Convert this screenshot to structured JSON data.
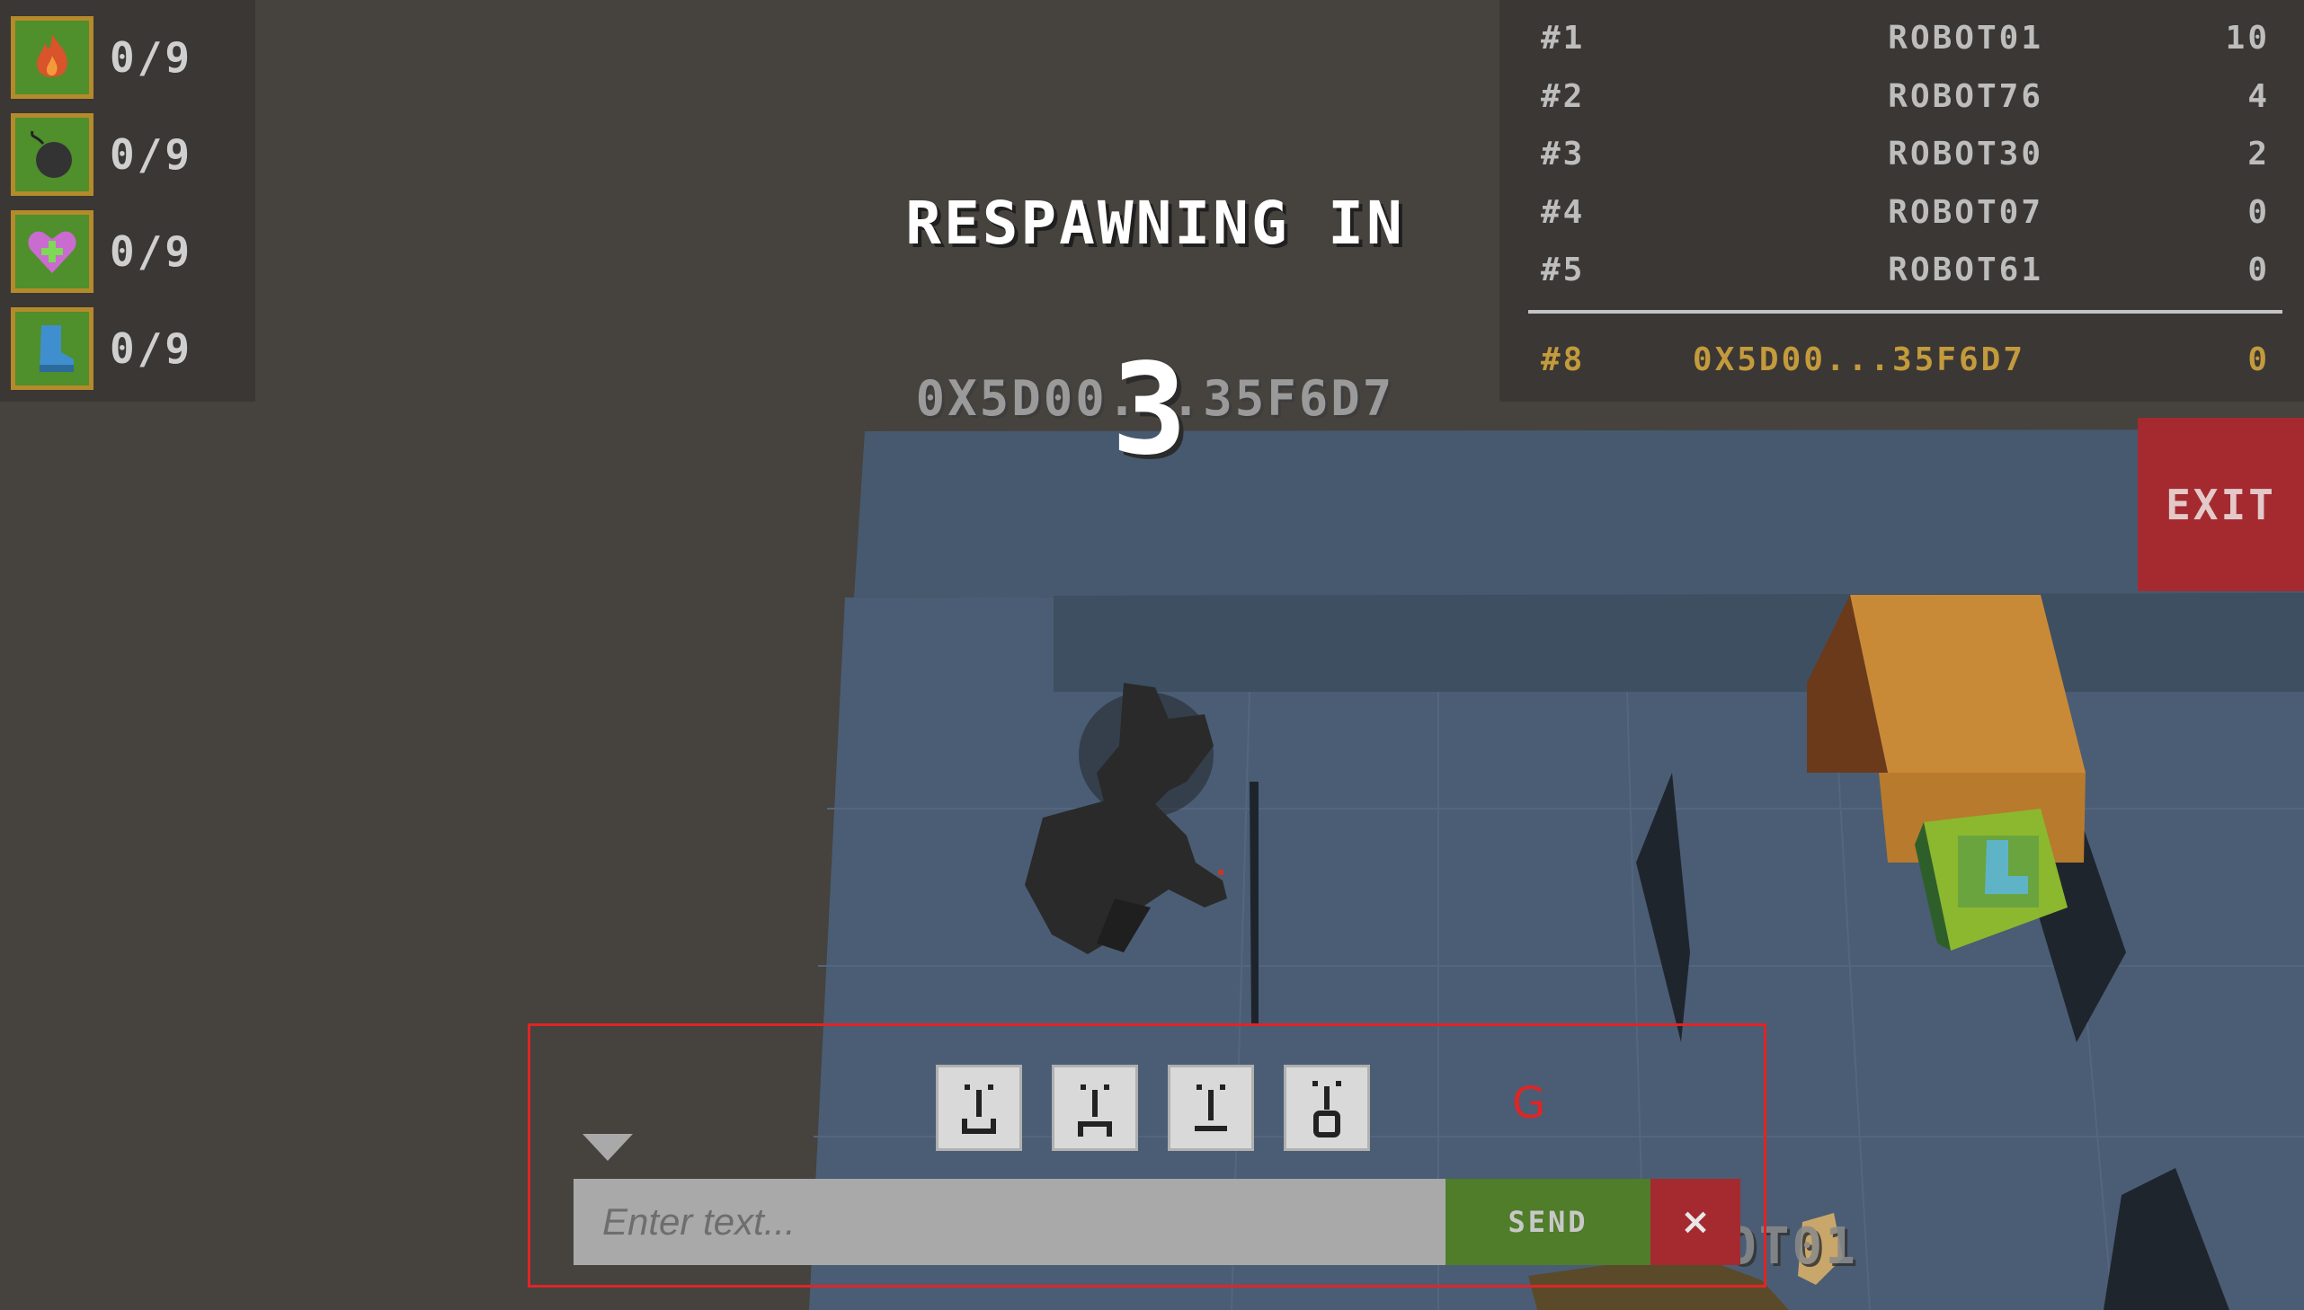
{
  "inventory": {
    "items": [
      {
        "icon": "fire-icon",
        "count": "0/9"
      },
      {
        "icon": "bomb-icon",
        "count": "0/9"
      },
      {
        "icon": "heart-icon",
        "count": "0/9"
      },
      {
        "icon": "boot-icon",
        "count": "0/9"
      }
    ]
  },
  "leaderboard": {
    "rows": [
      {
        "rank": "#1",
        "name": "ROBOT01",
        "score": "10"
      },
      {
        "rank": "#2",
        "name": "ROBOT76",
        "score": "4"
      },
      {
        "rank": "#3",
        "name": "ROBOT30",
        "score": "2"
      },
      {
        "rank": "#4",
        "name": "ROBOT07",
        "score": "0"
      },
      {
        "rank": "#5",
        "name": "ROBOT61",
        "score": "0"
      }
    ],
    "self": {
      "rank": "#8",
      "name": "0X5D00...35F6D7",
      "score": "0"
    }
  },
  "overlay": {
    "respawn_title": "RESPAWNING IN",
    "countdown": "3",
    "player_tag": "0X5D00...35F6D7"
  },
  "exit_label": "EXIT",
  "world": {
    "robot_label": "OT01"
  },
  "chat": {
    "hotkey": "G",
    "input_placeholder": "Enter text...",
    "input_value": "",
    "send_label": "SEND",
    "close_label": "×",
    "emotes": [
      "smile-emote-icon",
      "frown-emote-icon",
      "neutral-emote-icon",
      "surprised-emote-icon"
    ]
  },
  "colors": {
    "background": "#46423e",
    "panel": "#3a3734",
    "self_highlight": "#c39a3c",
    "exit_red": "#a52a2f",
    "send_green": "#4f7d2a",
    "chat_border": "#e02525"
  }
}
